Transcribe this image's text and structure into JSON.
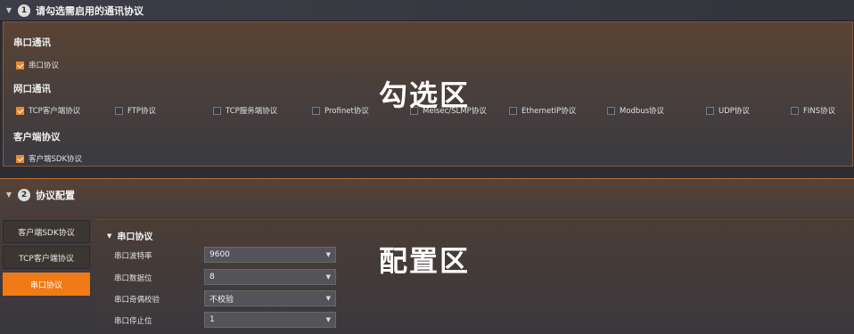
{
  "section1": {
    "number": "1",
    "title": "请勾选需启用的通讯协议"
  },
  "select_area": {
    "overlay_label": "勾选区",
    "groups": [
      {
        "title": "串口通讯",
        "items": [
          {
            "label": "串口协议",
            "checked": true
          }
        ]
      },
      {
        "title": "网口通讯",
        "items": [
          {
            "label": "TCP客户端协议",
            "checked": true
          },
          {
            "label": "FTP协议",
            "checked": false
          },
          {
            "label": "TCP服务端协议",
            "checked": false
          },
          {
            "label": "Profinet协议",
            "checked": false
          },
          {
            "label": "Melsec/SLMP协议",
            "checked": false
          },
          {
            "label": "EthernetIP协议",
            "checked": false
          },
          {
            "label": "Modbus协议",
            "checked": false
          },
          {
            "label": "UDP协议",
            "checked": false
          },
          {
            "label": "FINS协议",
            "checked": false
          }
        ]
      },
      {
        "title": "客户端协议",
        "items": [
          {
            "label": "客户端SDK协议",
            "checked": true
          }
        ]
      }
    ]
  },
  "section2": {
    "number": "2",
    "title": "协议配置"
  },
  "config": {
    "overlay_label": "配置区",
    "side_tabs": [
      {
        "label": "客户端SDK协议",
        "active": false
      },
      {
        "label": "TCP客户端协议",
        "active": false
      },
      {
        "label": "串口协议",
        "active": true
      }
    ],
    "panel_title": "串口协议",
    "fields": [
      {
        "label": "串口波特率",
        "value": "9600"
      },
      {
        "label": "串口数据位",
        "value": "8"
      },
      {
        "label": "串口奇偶校验",
        "value": "不校验"
      },
      {
        "label": "串口停止位",
        "value": "1"
      }
    ]
  },
  "colors": {
    "accent": "#f07a16",
    "checkbox_on": "#e58a2e",
    "border_orange": "#8a5a3a"
  },
  "icons": {
    "collapse": "triangle-down-icon",
    "check": "check-icon",
    "caret": "caret-down-icon"
  }
}
